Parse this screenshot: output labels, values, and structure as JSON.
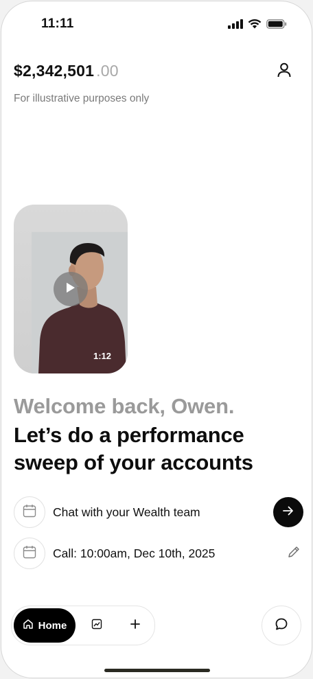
{
  "status_bar": {
    "time": "11:11",
    "icons": [
      "cellular-signal-icon",
      "wifi-icon",
      "battery-icon"
    ]
  },
  "header": {
    "balance_main": "$2,342,501",
    "balance_cents": ".00",
    "disclaimer": "For illustrative purposes only",
    "profile_icon": "user-icon"
  },
  "video": {
    "duration": "1:12",
    "play_icon": "play-icon"
  },
  "greeting": {
    "welcome": "Welcome back, Owen.",
    "headline": "Let’s do a performance sweep of your accounts"
  },
  "actions": [
    {
      "icon": "calendar-icon",
      "label": "Chat with your Wealth team",
      "trailing": "arrow-right-icon"
    },
    {
      "icon": "calendar-icon",
      "label": "Call: 10:00am, Dec 10th, 2025",
      "trailing": "pencil-icon"
    }
  ],
  "tab_bar": {
    "home_label": "Home",
    "home_icon": "home-icon",
    "chart_icon": "chart-icon",
    "add_icon": "plus-icon",
    "chat_icon": "chat-bubble-icon"
  },
  "colors": {
    "primary": "#000000",
    "muted_text": "#9a9a9a",
    "background": "#ffffff"
  }
}
